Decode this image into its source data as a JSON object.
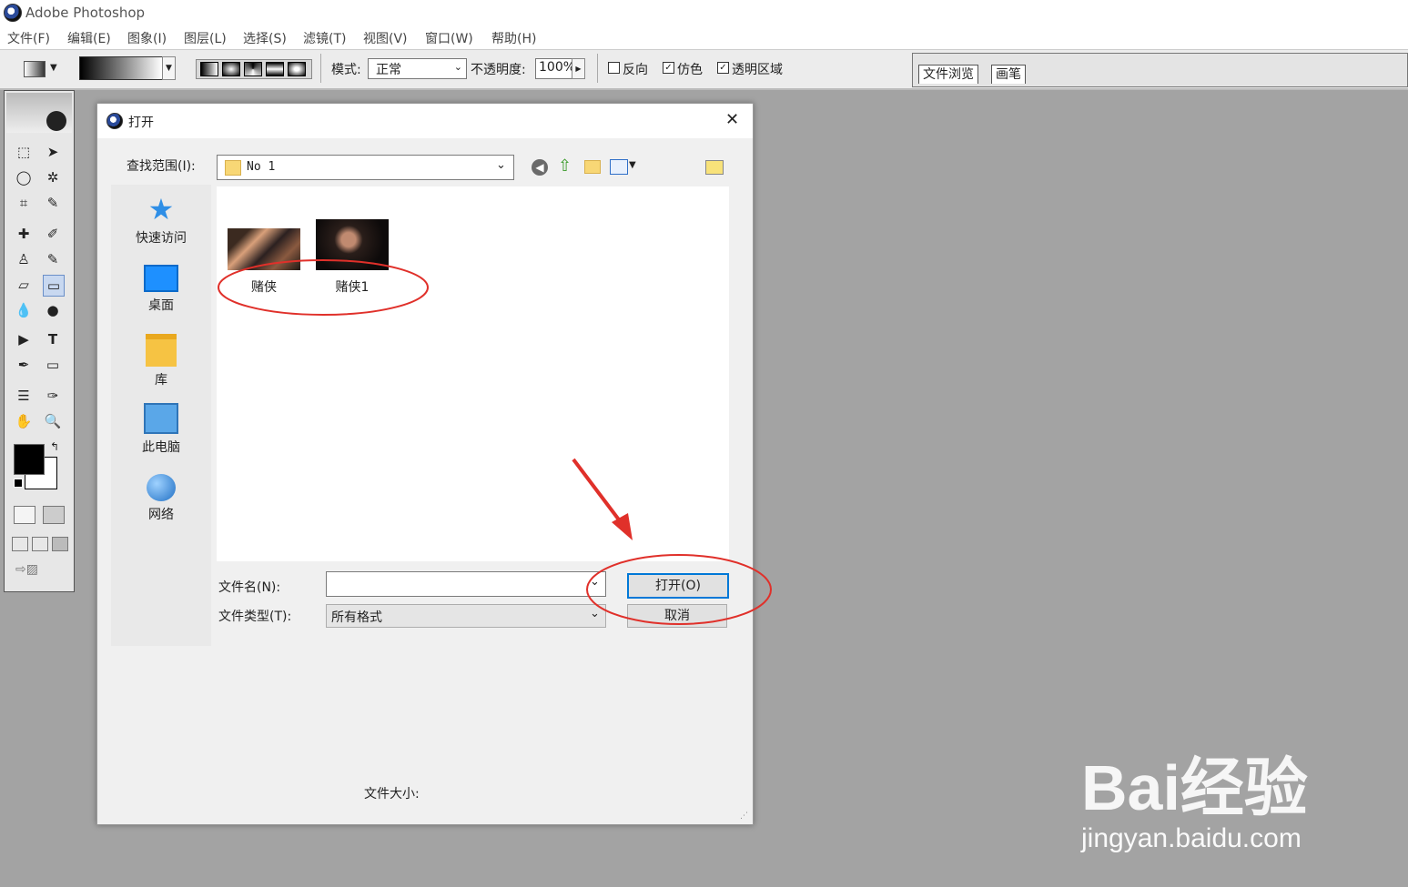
{
  "app": {
    "title": "Adobe Photoshop"
  },
  "menu": [
    "文件(F)",
    "编辑(E)",
    "图象(I)",
    "图层(L)",
    "选择(S)",
    "滤镜(T)",
    "视图(V)",
    "窗口(W)",
    "帮助(H)"
  ],
  "options": {
    "mode_label": "模式:",
    "mode_value": "正常",
    "opacity_label": "不透明度:",
    "opacity_value": "100%",
    "reverse_label": "反向",
    "dither_label": "仿色",
    "transparency_label": "透明区域",
    "reverse_checked": false,
    "dither_checked": true,
    "transparency_checked": true
  },
  "palette_tabs": [
    "文件浏览",
    "画笔"
  ],
  "dialog": {
    "title": "打开",
    "lookin_label": "查找范围(I):",
    "lookin_value": "No 1",
    "places": [
      "快速访问",
      "桌面",
      "库",
      "此电脑",
      "网络"
    ],
    "files": [
      "赌侠",
      "赌侠1"
    ],
    "filename_label": "文件名(N):",
    "filename_value": "",
    "filetype_label": "文件类型(T):",
    "filetype_value": "所有格式",
    "open_button": "打开(O)",
    "cancel_button": "取消",
    "filesize_label": "文件大小:"
  },
  "watermark": {
    "brand": "Bai经验",
    "url": "jingyan.baidu.com"
  },
  "colors": {
    "annotation": "#e0302a",
    "accent": "#2f7ed8",
    "canvas_bg": "#a3a3a3"
  }
}
